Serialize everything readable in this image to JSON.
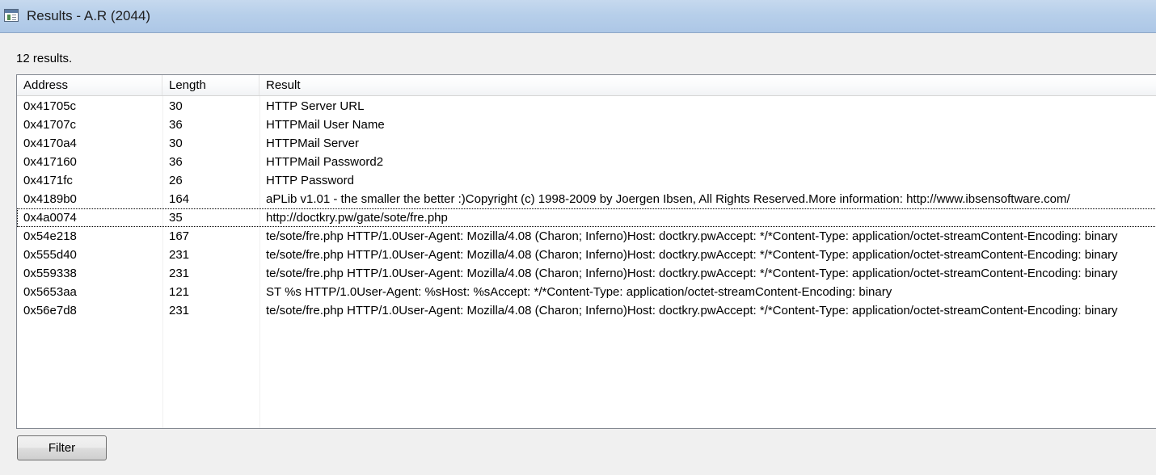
{
  "window": {
    "title": "Results - A.R (2044)"
  },
  "status": {
    "count_text": "12 results."
  },
  "table": {
    "columns": [
      "Address",
      "Length",
      "Result"
    ],
    "rows": [
      {
        "address": "0x41705c",
        "length": "30",
        "result": "HTTP Server URL"
      },
      {
        "address": "0x41707c",
        "length": "36",
        "result": "HTTPMail User Name"
      },
      {
        "address": "0x4170a4",
        "length": "30",
        "result": "HTTPMail Server"
      },
      {
        "address": "0x417160",
        "length": "36",
        "result": "HTTPMail Password2"
      },
      {
        "address": "0x4171fc",
        "length": "26",
        "result": "HTTP Password"
      },
      {
        "address": "0x4189b0",
        "length": "164",
        "result": "aPLib v1.01  -  the smaller the better :)Copyright (c) 1998-2009 by Joergen Ibsen, All Rights Reserved.More information: http://www.ibsensoftware.com/"
      },
      {
        "address": "0x4a0074",
        "length": "35",
        "result": "http://doctkry.pw/gate/sote/fre.php"
      },
      {
        "address": "0x54e218",
        "length": "167",
        "result": "te/sote/fre.php HTTP/1.0User-Agent: Mozilla/4.08 (Charon; Inferno)Host: doctkry.pwAccept: */*Content-Type: application/octet-streamContent-Encoding: binary"
      },
      {
        "address": "0x555d40",
        "length": "231",
        "result": "te/sote/fre.php HTTP/1.0User-Agent: Mozilla/4.08 (Charon; Inferno)Host: doctkry.pwAccept: */*Content-Type: application/octet-streamContent-Encoding: binary"
      },
      {
        "address": "0x559338",
        "length": "231",
        "result": "te/sote/fre.php HTTP/1.0User-Agent: Mozilla/4.08 (Charon; Inferno)Host: doctkry.pwAccept: */*Content-Type: application/octet-streamContent-Encoding: binary"
      },
      {
        "address": "0x5653aa",
        "length": "121",
        "result": "ST %s HTTP/1.0User-Agent: %sHost: %sAccept: */*Content-Type: application/octet-streamContent-Encoding: binary"
      },
      {
        "address": "0x56e7d8",
        "length": "231",
        "result": "te/sote/fre.php HTTP/1.0User-Agent: Mozilla/4.08 (Charon; Inferno)Host: doctkry.pwAccept: */*Content-Type: application/octet-streamContent-Encoding: binary"
      }
    ]
  },
  "buttons": {
    "filter_label": "Filter"
  }
}
